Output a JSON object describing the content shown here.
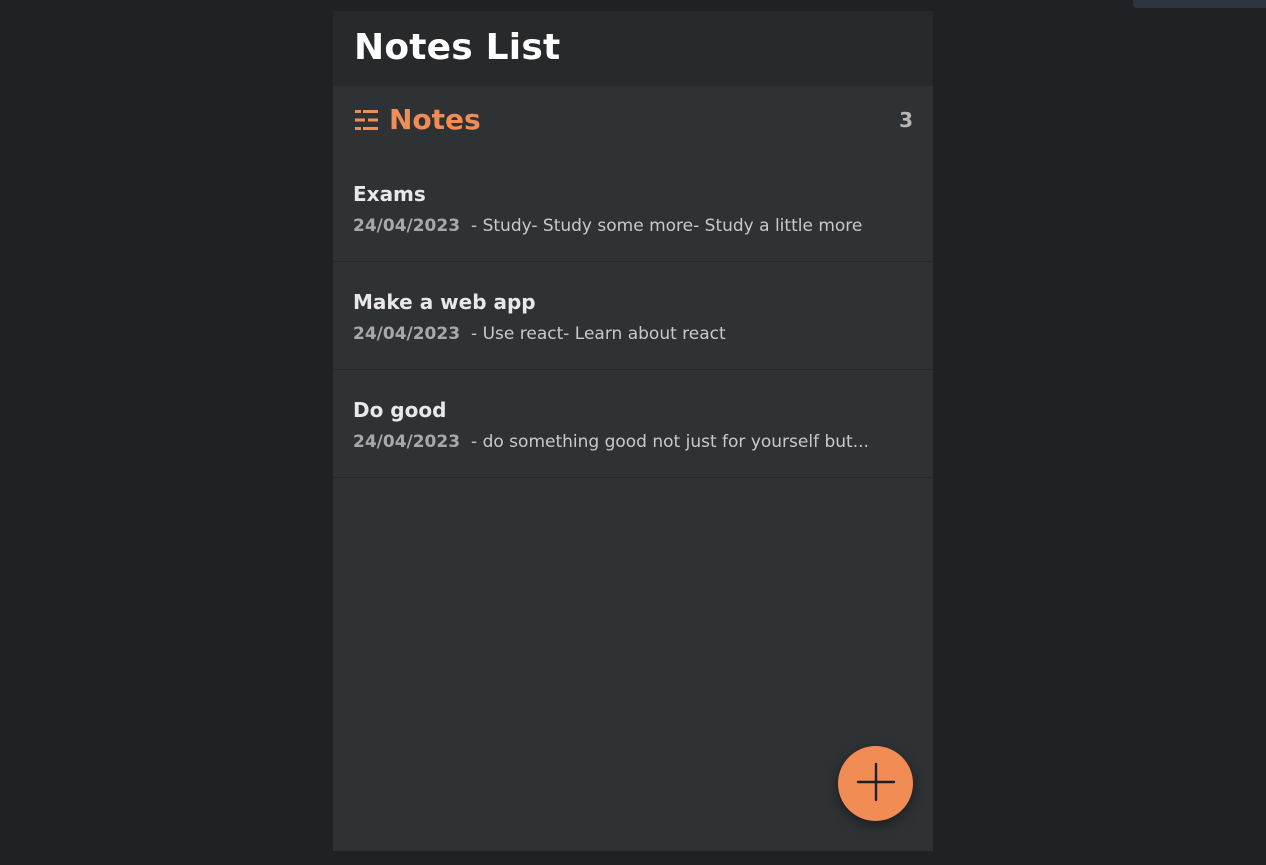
{
  "header": {
    "title": "Notes List"
  },
  "notes_section": {
    "title": "Notes",
    "count": "3",
    "icon": "list-icon"
  },
  "notes": [
    {
      "title": "Exams",
      "date": "24/04/2023",
      "preview": "- Study- Study some more- Study a little more"
    },
    {
      "title": "Make a web app",
      "date": "24/04/2023",
      "preview": "- Use react- Learn about react"
    },
    {
      "title": "Do good",
      "date": "24/04/2023",
      "preview": "- do something good not just for yourself but..."
    }
  ],
  "fab": {
    "icon": "plus-icon"
  },
  "colors": {
    "accent": "#f28c55",
    "background": "#202124",
    "panel": "#2f3235",
    "header": "#27292b"
  }
}
